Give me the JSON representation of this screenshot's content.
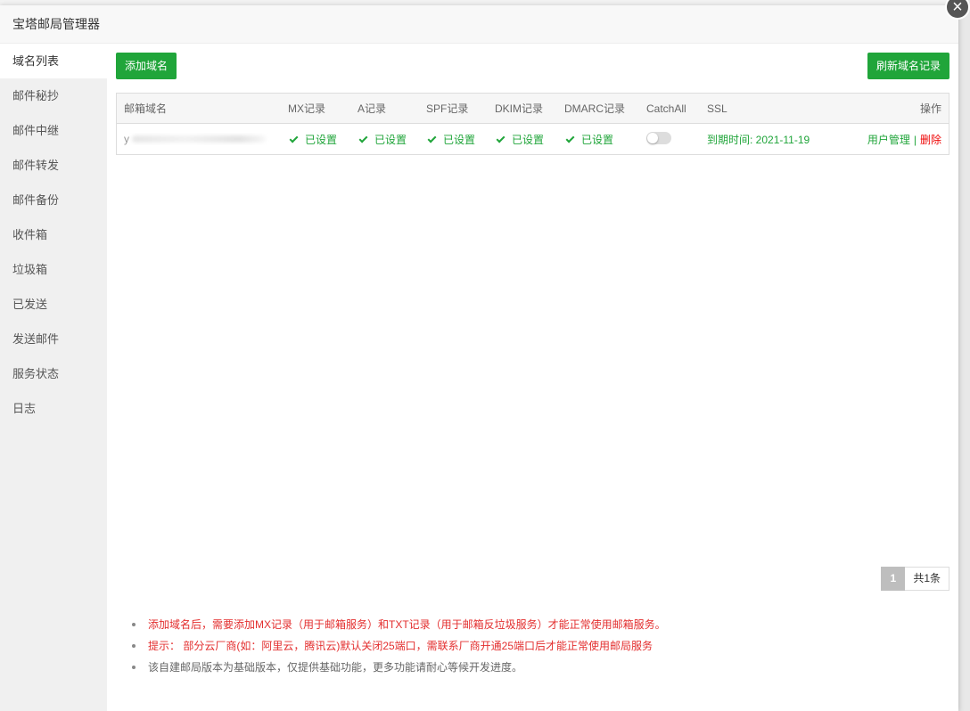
{
  "window": {
    "title": "宝塔邮局管理器",
    "close_glyph": "×"
  },
  "sidebar": {
    "items": [
      {
        "label": "域名列表",
        "active": true
      },
      {
        "label": "邮件秘抄"
      },
      {
        "label": "邮件中继"
      },
      {
        "label": "邮件转发"
      },
      {
        "label": "邮件备份"
      },
      {
        "label": "收件箱"
      },
      {
        "label": "垃圾箱"
      },
      {
        "label": "已发送"
      },
      {
        "label": "发送邮件"
      },
      {
        "label": "服务状态"
      },
      {
        "label": "日志"
      }
    ]
  },
  "toolbar": {
    "add_label": "添加域名",
    "refresh_label": "刷新域名记录"
  },
  "table": {
    "headers": {
      "domain": "邮箱域名",
      "mx": "MX记录",
      "a": "A记录",
      "spf": "SPF记录",
      "dkim": "DKIM记录",
      "dmarc": "DMARC记录",
      "catchall": "CatchAll",
      "ssl": "SSL",
      "ops": "操作"
    },
    "rows": [
      {
        "domain_visible_prefix": "y",
        "mx": "已设置",
        "a": "已设置",
        "spf": "已设置",
        "dkim": "已设置",
        "dmarc": "已设置",
        "catchall_on": false,
        "ssl": "到期时间: 2021-11-19",
        "user_manage": "用户管理",
        "separator": "|",
        "delete": "删除"
      }
    ]
  },
  "pager": {
    "current": "1",
    "total": "共1条"
  },
  "notes": [
    "添加域名后，需要添加MX记录（用于邮箱服务）和TXT记录（用于邮箱反垃圾服务）才能正常使用邮箱服务。",
    "提示：  部分云厂商(如：阿里云，腾讯云)默认关闭25端口，需联系厂商开通25端口后才能正常使用邮局服务",
    "该自建邮局版本为基础版本，仅提供基础功能，更多功能请耐心等候开发进度。"
  ],
  "colors": {
    "brand_green": "#20a53a",
    "danger_red": "#ef0808",
    "note_red": "#e32e2e"
  }
}
